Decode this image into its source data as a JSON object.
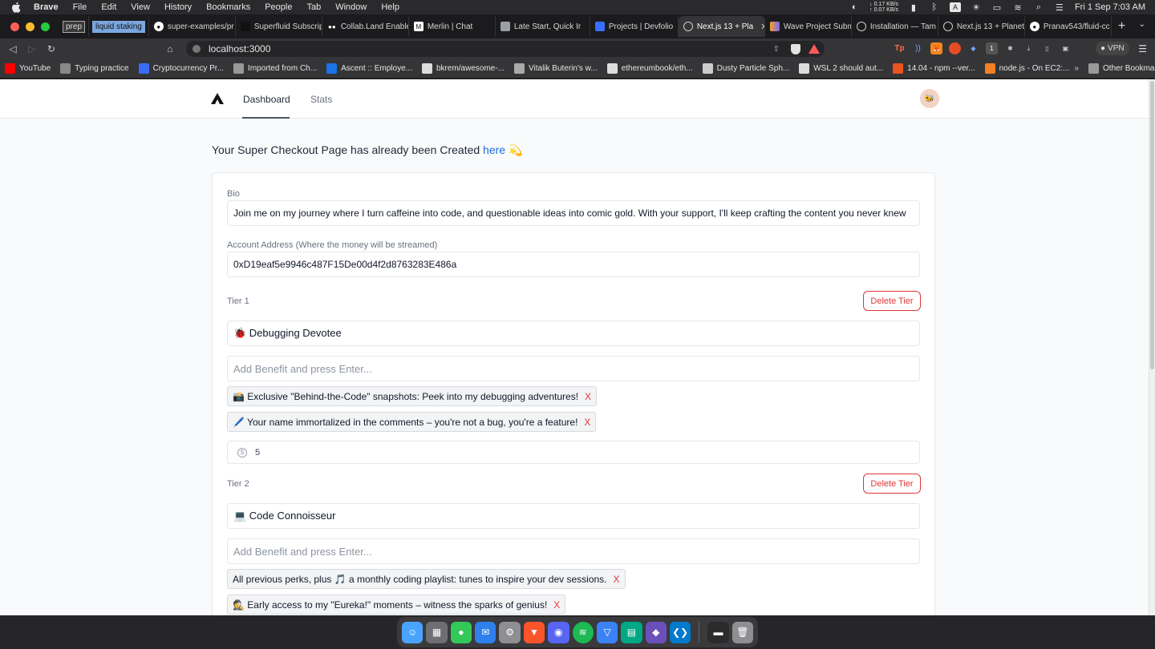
{
  "menubar": {
    "items": [
      "Brave",
      "File",
      "Edit",
      "View",
      "History",
      "Bookmarks",
      "People",
      "Tab",
      "Window",
      "Help"
    ],
    "net_up": "0.17 KB/s",
    "net_down": "0.07 KB/s",
    "clock": "Fri 1 Sep  7:03 AM"
  },
  "tabs": [
    {
      "label": "prep",
      "kind": "chip"
    },
    {
      "label": "liquid staking",
      "kind": "chip-blue"
    },
    {
      "label": "super-examples/pr",
      "icon": "github-icon"
    },
    {
      "label": "Superfluid Subscrip",
      "icon": "superfluid-icon"
    },
    {
      "label": "Collab.Land Enable",
      "icon": "collabland-icon"
    },
    {
      "label": "Merlin | Chat",
      "icon": "merlin-icon"
    },
    {
      "label": "Late Start, Quick Ir",
      "icon": "page-icon"
    },
    {
      "label": "Projects | Devfolio",
      "icon": "devfolio-icon"
    },
    {
      "label": "Next.js 13 + Pla",
      "icon": "globe-icon",
      "active": true
    },
    {
      "label": "Wave Project Subm",
      "icon": "wave-icon"
    },
    {
      "label": "Installation — Tam",
      "icon": "tamagui-icon"
    },
    {
      "label": "Next.js 13 + Planet",
      "icon": "globe-icon"
    },
    {
      "label": "Pranav543/fluid-cc",
      "icon": "github-icon"
    }
  ],
  "address": {
    "url": "localhost:3000"
  },
  "extensions": {
    "vpn_label": "VPN",
    "badge": "1"
  },
  "bookmarks": [
    {
      "label": "YouTube",
      "icon": "youtube-icon",
      "color": "#ff0000"
    },
    {
      "label": "Typing practice",
      "icon": "keyboard-icon",
      "color": "#888888"
    },
    {
      "label": "Cryptocurrency Pr...",
      "icon": "coin-icon",
      "color": "#3b6cf6"
    },
    {
      "label": "Imported from Ch...",
      "icon": "folder-icon",
      "color": "#999999"
    },
    {
      "label": "Ascent :: Employe...",
      "icon": "ascent-icon",
      "color": "#1a73e8"
    },
    {
      "label": "bkrem/awesome-...",
      "icon": "github-icon",
      "color": "#dddddd"
    },
    {
      "label": "Vitalik Buterin's w...",
      "icon": "globe-icon",
      "color": "#aaaaaa"
    },
    {
      "label": "ethereumbook/eth...",
      "icon": "github-icon",
      "color": "#dddddd"
    },
    {
      "label": "Dusty Particle Sph...",
      "icon": "particle-icon",
      "color": "#cccccc"
    },
    {
      "label": "WSL 2 should aut...",
      "icon": "github-icon",
      "color": "#dddddd"
    },
    {
      "label": "14.04 - npm --ver...",
      "icon": "askubuntu-icon",
      "color": "#e95420"
    },
    {
      "label": "node.js - On EC2:...",
      "icon": "stackoverflow-icon",
      "color": "#f48024"
    }
  ],
  "bookmarks_other": "Other Bookmarks",
  "bookmarks_more": "»",
  "app": {
    "nav": {
      "dashboard": "Dashboard",
      "stats": "Stats"
    },
    "headline_prefix": "Your Super Checkout Page has already been Created ",
    "headline_link": "here",
    "headline_emoji": "💫",
    "bio_label": "Bio",
    "bio_value": "Join me on my journey where I turn caffeine into code, and questionable ideas into comic gold. With your support, I'll keep crafting the content you never knew",
    "account_label": "Account Address (Where the money will be streamed)",
    "account_value": "0xD19eaf5e9946c487F15De00d4f2d8763283E486a",
    "benefit_placeholder": "Add Benefit and press Enter...",
    "delete_label": "Delete Tier",
    "remove_glyph": "X",
    "tiers": [
      {
        "label": "Tier 1",
        "name": "🐞 Debugging Devotee",
        "benefits": [
          "📸 Exclusive \"Behind-the-Code\" snapshots: Peek into my debugging adventures!",
          "🖊️ Your name immortalized in the comments – you're not a bug, you're a feature!"
        ],
        "price": "5"
      },
      {
        "label": "Tier 2",
        "name": "💻 Code Connoisseur",
        "benefits": [
          "All previous perks, plus 🎵 a monthly coding playlist: tunes to inspire your dev sessions.",
          "🕵️ Early access to my \"Eureka!\" moments – witness the sparks of genius!"
        ]
      }
    ]
  },
  "colors": {
    "accent_link": "#1d6fe0",
    "danger": "#e0363a",
    "page_bg": "#f9fafb"
  }
}
